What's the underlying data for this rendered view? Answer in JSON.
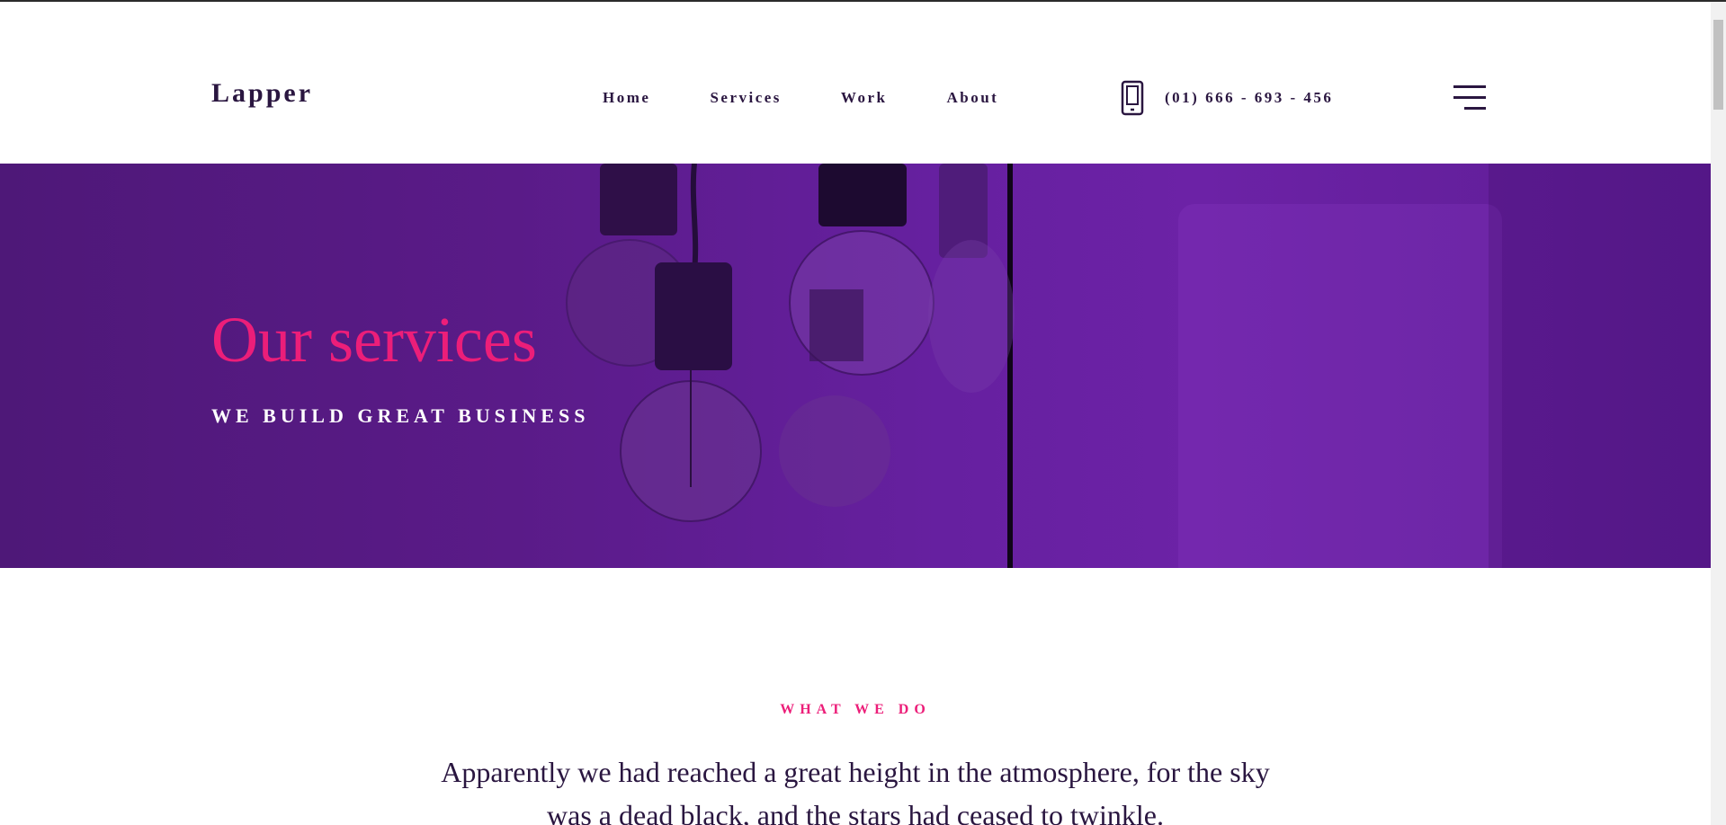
{
  "header": {
    "logo": "Lapper",
    "nav": [
      {
        "label": "Home"
      },
      {
        "label": "Services"
      },
      {
        "label": "Work"
      },
      {
        "label": "About"
      }
    ],
    "phone": "(01) 666 - 693 - 456",
    "icons": {
      "phone": "smartphone-icon",
      "menu": "hamburger-menu-icon"
    }
  },
  "hero": {
    "title": "Our services",
    "subtitle": "WE BUILD GREAT BUSINESS"
  },
  "what_we_do": {
    "label": "WHAT WE DO",
    "text": "Apparently we had reached a great height in the atmosphere, for the sky was a dead black, and the stars had ceased to twinkle."
  },
  "colors": {
    "accent": "#ec1e79",
    "dark": "#2a1640",
    "hero_purple": "#6620a0"
  }
}
